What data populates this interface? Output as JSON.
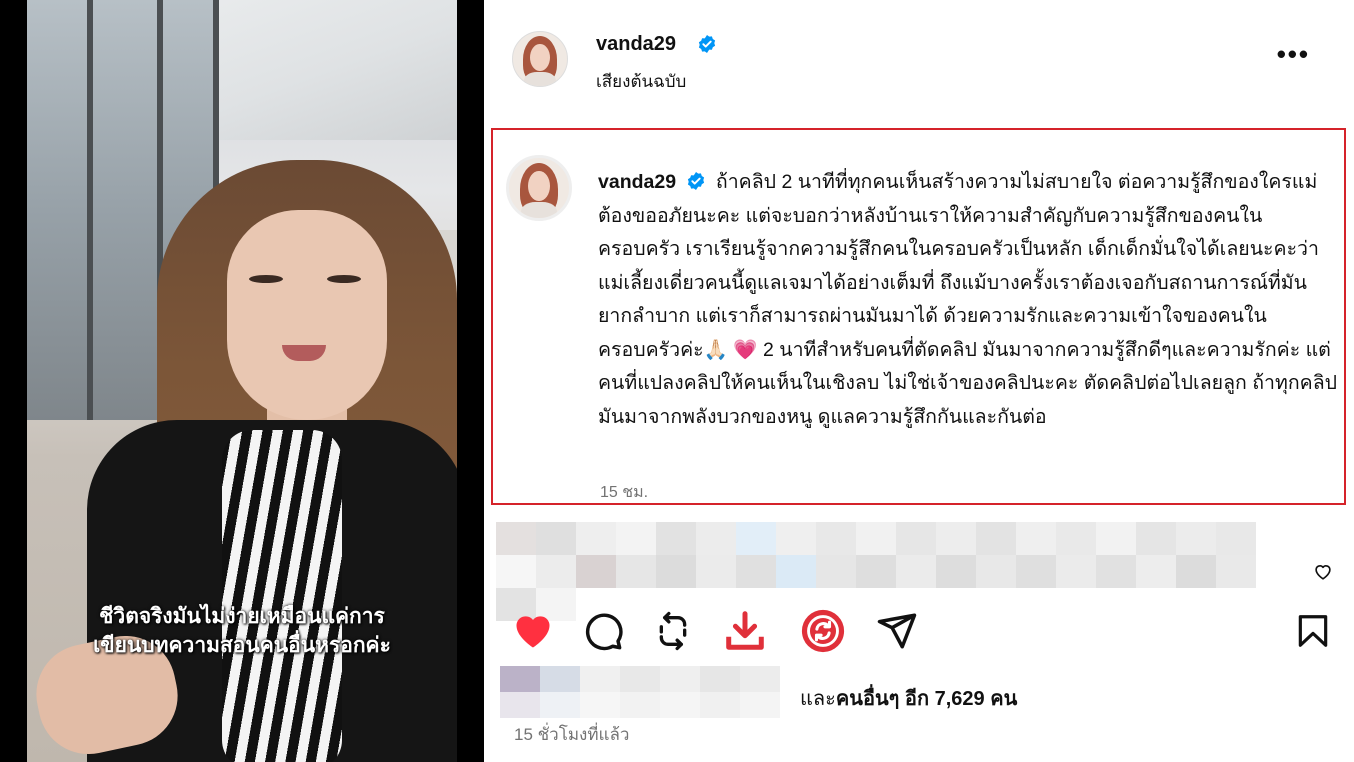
{
  "video": {
    "subtitle_line1": "ชีวิตจริงมันไม่ง่ายเหมือนแค่การ",
    "subtitle_line2": "เขียนบทความสอนคนอื่นหรอกค่ะ"
  },
  "header": {
    "username": "vanda29",
    "audio_label": "เสียงต้นฉบับ",
    "more_icon": "more-options-icon"
  },
  "caption": {
    "username": "vanda29",
    "text": "ถ้าคลิป 2 นาทีที่ทุกคนเห็นสร้างความไม่สบายใจ ต่อความรู้สึกของใครแม่ต้องขออภัยนะคะ แต่จะบอกว่าหลังบ้านเราให้ความสำคัญกับความรู้สึกของคนในครอบครัว เราเรียนรู้จากความรู้สึกคนในครอบครัวเป็นหลัก เด็กเด็กมั่นใจได้เลยนะคะว่า แม่เลี้ยงเดี่ยวคนนี้ดูแลเจมาได้อย่างเต็มที่ ถึงแม้บางครั้งเราต้องเจอกับสถานการณ์ที่มันยากลำบาก แต่เราก็สามารถผ่านมันมาได้ ด้วยความรักและความเข้าใจของคนในครอบครัวค่ะ",
    "emoji_1": "🙏🏻",
    "emoji_2": "💗",
    "text_2": " 2 นาทีสำหรับคนที่ตัดคลิป มันมาจากความรู้สึกดีๆและความรักค่ะ แต่คนที่แปลงคลิปให้คนเห็นในเชิงลบ ไม่ใช่เจ้าของคลิปนะคะ ตัดคลิปต่อไปเลยลูก ถ้าทุกคลิปมันมาจากพลังบวกของหนู ดูแลความรู้สึกกันและกันต่อ",
    "time": "15 ชม."
  },
  "likes": {
    "prefix": "และ",
    "others_label": "คนอื่นๆ",
    "count_text": " อีก 7,629 คน"
  },
  "post_time": "15 ชั่วโมงที่แล้ว",
  "colors": {
    "like_red": "#ff3040",
    "highlight_border": "#d5232a",
    "verified_blue": "#0095f6",
    "download_red": "#e0303a"
  }
}
